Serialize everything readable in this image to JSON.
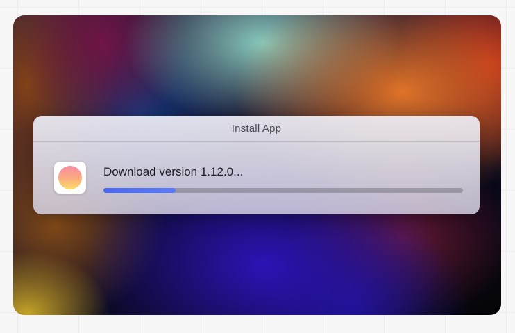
{
  "dialog": {
    "title": "Install App",
    "status_text": "Download version 1.12.0...",
    "progress_percent": 20,
    "app_icon": "app-logo-icon"
  },
  "colors": {
    "progress_fill": "#4a68f0",
    "progress_track": "#8a8896",
    "app_icon_gradient": [
      "#f78aa4",
      "#fde06a"
    ]
  }
}
